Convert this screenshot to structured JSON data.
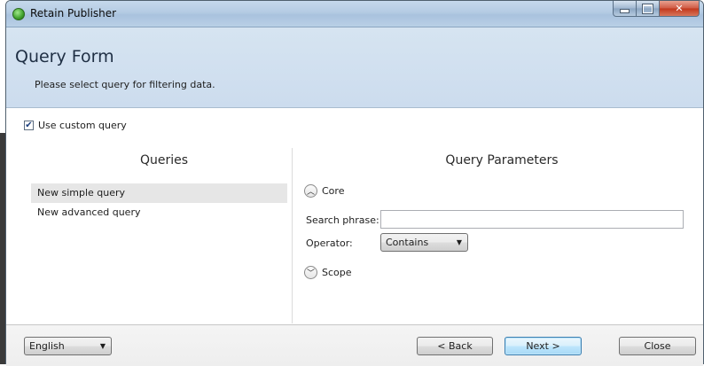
{
  "window": {
    "title": "Retain Publisher"
  },
  "header": {
    "title": "Query Form",
    "subtitle": "Please select query for filtering data."
  },
  "custom_query": {
    "label": "Use custom query",
    "checked": true
  },
  "queries": {
    "title": "Queries",
    "items": [
      {
        "label": "New simple query",
        "selected": true
      },
      {
        "label": "New advanced query",
        "selected": false
      }
    ]
  },
  "parameters": {
    "title": "Query Parameters",
    "core": {
      "label": "Core",
      "expanded": true
    },
    "search_phrase": {
      "label": "Search phrase:",
      "value": ""
    },
    "operator": {
      "label": "Operator:",
      "value": "Contains"
    },
    "scope": {
      "label": "Scope",
      "expanded": false
    }
  },
  "footer": {
    "language": "English",
    "back_label": "< Back",
    "next_label": "Next >",
    "close_label": "Close"
  },
  "icons": {
    "app": "app-circle-icon",
    "collapse": "chevron-up-icon",
    "expand": "chevron-down-icon",
    "dropdown": "caret-down-icon"
  }
}
